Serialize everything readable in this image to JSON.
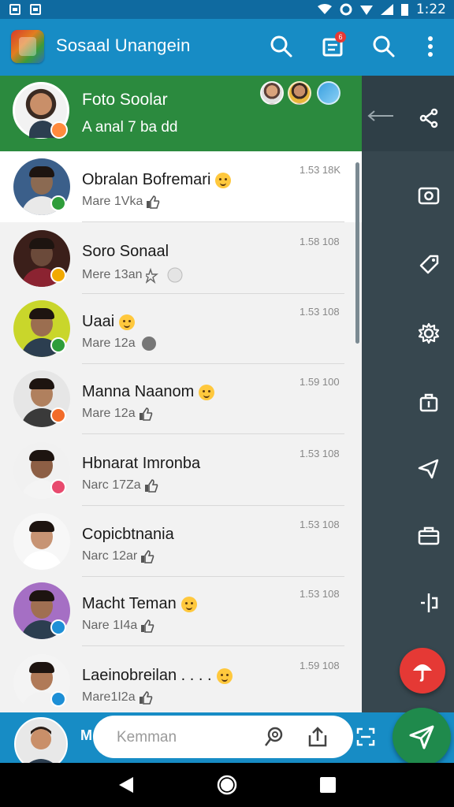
{
  "status_bar": {
    "time": "1:22"
  },
  "app_bar": {
    "title": "Sosaal Unangein",
    "icons": [
      "search-icon",
      "clipboard-icon",
      "search-icon",
      "more-vert-icon"
    ],
    "badge": "6"
  },
  "profile": {
    "name": "Foto Soolar",
    "status": "A anal 7 ba dd"
  },
  "chats": [
    {
      "name": "Obralan Bofremari",
      "sub": "Mare 1Vka",
      "time": "1.53 18K",
      "emoji": true,
      "thumb": true,
      "badge_color": "#2e9d3a"
    },
    {
      "name": "Soro Sonaal",
      "sub": "Mere 13an",
      "time": "1.58 108",
      "emoji": false,
      "thumb": false,
      "badge_color": "#f2a900"
    },
    {
      "name": "Uaai",
      "sub": "Mare 12a",
      "time": "1.53 108",
      "emoji": true,
      "thumb": false,
      "badge_color": "#2e9d3a"
    },
    {
      "name": "Manna Naanom",
      "sub": "Mare 12a",
      "time": "1.59 100",
      "emoji": true,
      "thumb": true,
      "badge_color": "#f26c2a"
    },
    {
      "name": "Hbnarat Imronba",
      "sub": "Narc 17Za",
      "time": "1.53 108",
      "emoji": false,
      "thumb": true,
      "badge_color": "#e84a6e"
    },
    {
      "name": "Copicbtnania",
      "sub": "Narc 12ar",
      "time": "1.53 108",
      "emoji": false,
      "thumb": true,
      "badge_color": ""
    },
    {
      "name": "Macht Teman",
      "sub": "Nare 1I4a",
      "time": "1.53 108",
      "emoji": true,
      "thumb": true,
      "badge_color": "#1d8fd6"
    },
    {
      "name": "Laeinobreilan . . . .",
      "sub": "Mare1I2a",
      "time": "1.59 108",
      "emoji": true,
      "thumb": true,
      "badge_color": "#1d8fd6"
    }
  ],
  "composer": {
    "placeholder": "Kemman",
    "letter": "M"
  },
  "rail_icons": [
    "share-icon",
    "camera-icon",
    "tag-icon",
    "gear-icon",
    "bag-icon",
    "pin-icon",
    "briefcase-icon",
    "split-icon"
  ],
  "colors": {
    "app_bar": "#178cc5",
    "header_green": "#2b8a3e",
    "rail": "#37474f",
    "fab_red": "#e53935",
    "fab_green": "#1f8a4c"
  }
}
